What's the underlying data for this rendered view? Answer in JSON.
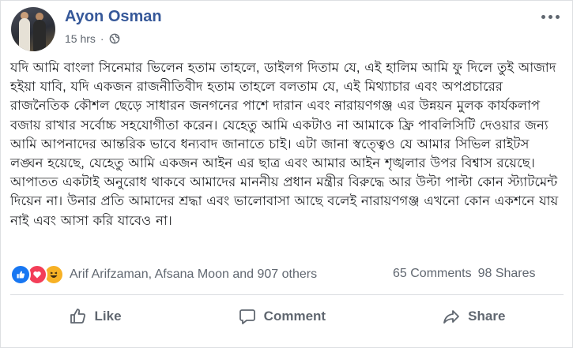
{
  "post": {
    "author": "Ayon Osman",
    "time": "15 hrs",
    "separator": "·",
    "privacy_icon": "globe-icon",
    "body": "যদি আমি বাংলা সিনেমার ভিলেন হতাম তাহলে, ডাইলগ দিতাম যে, এই হালিম আমি ফু দিলে তুই আজাদ হইয়া যাবি, যদি একজন রাজনীতিবীদ হতাম তাহলে বলতাম যে, এই মিথ্যাচার এবং অপপ্রচারের রাজনৈতিক কৌশল ছেড়ে সাধারন জনগনের পাশে দারান এবং নারায়ণগঞ্জ এর উন্নয়ন মুলক কার্যকলাপ বজায় রাখার সর্বোচ্চ সহযোগীতা করেন। যেহেতু আমি একটাও না আমাকে ফ্রি পাবলিসিটি দেওয়ার জন্য আমি আপনাদের আন্তরিক ভাবে ধন্যবাদ জানাতে চাই। এটা জানা স্বত্ত্বেও যে আমার সিভিল রাইটস লঙ্ঘন হয়েছে, যেহেতু আমি একজন আইন এর ছাত্র এবং আমার আইন শৃঙ্খলার উপর বিশ্বাস রয়েছে। আপাতত একটাই অনুরোধ থাকবে আমাদের মাননীয় প্রধান মন্ত্রীর বিরুদ্ধে আর উল্টা পাল্টা কোন স্ট্যাটমেন্ট দিয়েন না। উনার প্রতি আমাদের শ্রদ্ধা এবং ভালোবাসা আছে বলেই নারায়ণগঞ্জ এখনো কোন একশনে যায় নাই এবং আসা করি যাবেও না।"
  },
  "reactions": {
    "icons": [
      "like-icon",
      "love-icon",
      "haha-icon"
    ],
    "names": "Arif Arifzaman, Afsana Moon and 907 others",
    "comments": "65 Comments",
    "shares": "98 Shares"
  },
  "actions": {
    "like": "Like",
    "comment": "Comment",
    "share": "Share"
  },
  "colors": {
    "author": "#365899",
    "meta": "#606770",
    "like": "#1877f2",
    "love": "#f33e58",
    "haha": "#f7b125"
  }
}
